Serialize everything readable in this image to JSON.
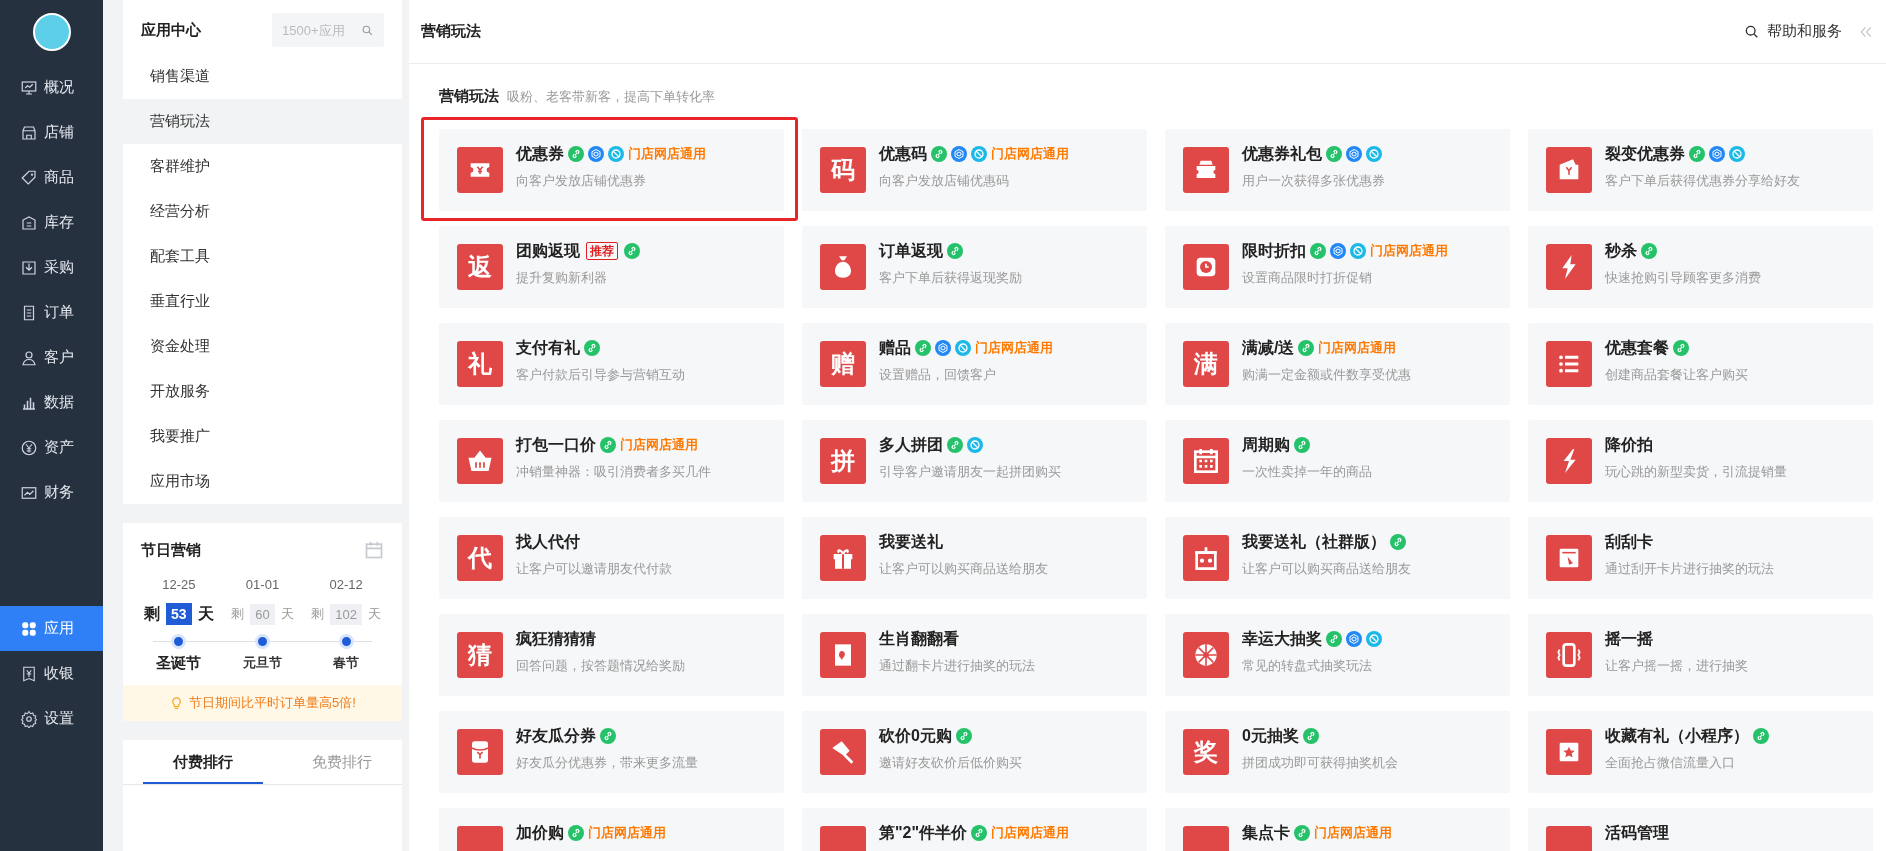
{
  "nav": {
    "items": [
      {
        "label": "概况",
        "selected": false
      },
      {
        "label": "店铺",
        "selected": false
      },
      {
        "label": "商品",
        "selected": false
      },
      {
        "label": "库存",
        "selected": false
      },
      {
        "label": "采购",
        "selected": false
      },
      {
        "label": "订单",
        "selected": false
      },
      {
        "label": "客户",
        "selected": false
      },
      {
        "label": "数据",
        "selected": false
      },
      {
        "label": "资产",
        "selected": false
      },
      {
        "label": "财务",
        "selected": false
      }
    ],
    "bottom_items": [
      {
        "label": "应用",
        "selected": true
      },
      {
        "label": "收银",
        "selected": false
      },
      {
        "label": "设置",
        "selected": false
      }
    ]
  },
  "app_center": {
    "title": "应用中心",
    "search": {
      "placeholder": "1500+应用"
    },
    "menu": [
      {
        "label": "销售渠道",
        "selected": false
      },
      {
        "label": "营销玩法",
        "selected": true
      },
      {
        "label": "客群维护",
        "selected": false
      },
      {
        "label": "经营分析",
        "selected": false
      },
      {
        "label": "配套工具",
        "selected": false
      },
      {
        "label": "垂直行业",
        "selected": false
      },
      {
        "label": "资金处理",
        "selected": false
      },
      {
        "label": "开放服务",
        "selected": false
      },
      {
        "label": "我要推广",
        "selected": false
      },
      {
        "label": "应用市场",
        "selected": false
      }
    ]
  },
  "festival": {
    "title": "节日营销",
    "items": [
      {
        "date": "12-25",
        "prefix": "剩",
        "days": "53",
        "suffix": "天",
        "name": "圣诞节",
        "selected": true
      },
      {
        "date": "01-01",
        "prefix": "剩",
        "days": "60",
        "suffix": "天",
        "name": "元旦节",
        "selected": false
      },
      {
        "date": "02-12",
        "prefix": "剩",
        "days": "102",
        "suffix": "天",
        "name": "春节",
        "selected": false
      }
    ],
    "tip": "节日期间比平时订单量高5倍!"
  },
  "ranking_tabs": [
    {
      "label": "付费排行",
      "selected": true
    },
    {
      "label": "免费排行",
      "selected": false
    }
  ],
  "header": {
    "title": "营销玩法",
    "help": "帮助和服务"
  },
  "section": {
    "title": "营销玩法",
    "subtitle": "吸粉、老客带新客，提高下单转化率"
  },
  "cards": [
    {
      "title": "优惠券",
      "desc": "向客户发放店铺优惠券",
      "highlighted": true,
      "badges": [
        {
          "kind": "link"
        },
        {
          "kind": "hex"
        },
        {
          "kind": "ring"
        },
        {
          "kind": "scope",
          "text": "门店网店通用"
        }
      ]
    },
    {
      "title": "优惠码",
      "icon_text": "码",
      "desc": "向客户发放店铺优惠码",
      "highlighted": false,
      "badges": [
        {
          "kind": "link"
        },
        {
          "kind": "hex"
        },
        {
          "kind": "ring"
        },
        {
          "kind": "scope",
          "text": "门店网店通用"
        }
      ]
    },
    {
      "title": "优惠券礼包",
      "desc": "用户一次获得多张优惠券",
      "highlighted": false,
      "badges": [
        {
          "kind": "link"
        },
        {
          "kind": "hex"
        },
        {
          "kind": "ring"
        }
      ]
    },
    {
      "title": "裂变优惠券",
      "desc": "客户下单后获得优惠券分享给好友",
      "highlighted": false,
      "badges": [
        {
          "kind": "link"
        },
        {
          "kind": "hex"
        },
        {
          "kind": "ring"
        }
      ]
    },
    {
      "title": "团购返现",
      "icon_text": "返",
      "desc": "提升复购新利器",
      "highlighted": false,
      "badges": [
        {
          "kind": "hot",
          "text": "推荐"
        },
        {
          "kind": "link"
        }
      ]
    },
    {
      "title": "订单返现",
      "desc": "客户下单后获得返现奖励",
      "highlighted": false,
      "badges": [
        {
          "kind": "link"
        }
      ]
    },
    {
      "title": "限时折扣",
      "desc": "设置商品限时打折促销",
      "highlighted": false,
      "badges": [
        {
          "kind": "link"
        },
        {
          "kind": "hex"
        },
        {
          "kind": "ring"
        },
        {
          "kind": "scope",
          "text": "门店网店通用"
        }
      ]
    },
    {
      "title": "秒杀",
      "desc": "快速抢购引导顾客更多消费",
      "highlighted": false,
      "badges": [
        {
          "kind": "link"
        }
      ]
    },
    {
      "title": "支付有礼",
      "icon_text": "礼",
      "desc": "客户付款后引导参与营销互动",
      "highlighted": false,
      "badges": [
        {
          "kind": "link"
        }
      ]
    },
    {
      "title": "赠品",
      "icon_text": "赠",
      "desc": "设置赠品，回馈客户",
      "highlighted": false,
      "badges": [
        {
          "kind": "link"
        },
        {
          "kind": "hex"
        },
        {
          "kind": "ring"
        },
        {
          "kind": "scope",
          "text": "门店网店通用"
        }
      ]
    },
    {
      "title": "满减/送",
      "icon_text": "满",
      "desc": "购满一定金额或件数享受优惠",
      "highlighted": false,
      "badges": [
        {
          "kind": "link"
        },
        {
          "kind": "scope",
          "text": "门店网店通用"
        }
      ]
    },
    {
      "title": "优惠套餐",
      "desc": "创建商品套餐让客户购买",
      "highlighted": false,
      "badges": [
        {
          "kind": "link"
        }
      ]
    },
    {
      "title": "打包一口价",
      "desc": "冲销量神器：吸引消费者多买几件",
      "highlighted": false,
      "badges": [
        {
          "kind": "link"
        },
        {
          "kind": "scope",
          "text": "门店网店通用"
        }
      ]
    },
    {
      "title": "多人拼团",
      "icon_text": "拼",
      "desc": "引导客户邀请朋友一起拼团购买",
      "highlighted": false,
      "badges": [
        {
          "kind": "link"
        },
        {
          "kind": "ring"
        }
      ]
    },
    {
      "title": "周期购",
      "desc": "一次性卖掉一年的商品",
      "highlighted": false,
      "badges": [
        {
          "kind": "link"
        }
      ]
    },
    {
      "title": "降价拍",
      "desc": "玩心跳的新型卖货，引流提销量",
      "highlighted": false
    },
    {
      "title": "找人代付",
      "icon_text": "代",
      "desc": "让客户可以邀请朋友代付款",
      "highlighted": false
    },
    {
      "title": "我要送礼",
      "desc": "让客户可以购买商品送给朋友",
      "highlighted": false
    },
    {
      "title": "我要送礼（社群版）",
      "desc": "让客户可以购买商品送给朋友",
      "highlighted": false,
      "badges": [
        {
          "kind": "link"
        }
      ]
    },
    {
      "title": "刮刮卡",
      "desc": "通过刮开卡片进行抽奖的玩法",
      "highlighted": false
    },
    {
      "title": "疯狂猜猜猜",
      "icon_text": "猜",
      "desc": "回答问题，按答题情况给奖励",
      "highlighted": false
    },
    {
      "title": "生肖翻翻看",
      "desc": "通过翻卡片进行抽奖的玩法",
      "highlighted": false
    },
    {
      "title": "幸运大抽奖",
      "desc": "常见的转盘式抽奖玩法",
      "highlighted": false,
      "badges": [
        {
          "kind": "link"
        },
        {
          "kind": "hex"
        },
        {
          "kind": "ring"
        }
      ]
    },
    {
      "title": "摇一摇",
      "desc": "让客户摇一摇，进行抽奖",
      "highlighted": false
    },
    {
      "title": "好友瓜分券",
      "desc": "好友瓜分优惠券，带来更多流量",
      "highlighted": false,
      "badges": [
        {
          "kind": "link"
        }
      ]
    },
    {
      "title": "砍价0元购",
      "desc": "邀请好友砍价后低价购买",
      "highlighted": false,
      "badges": [
        {
          "kind": "link"
        }
      ]
    },
    {
      "title": "0元抽奖",
      "icon_text": "奖",
      "desc": "拼团成功即可获得抽奖机会",
      "highlighted": false,
      "badges": [
        {
          "kind": "link"
        }
      ]
    },
    {
      "title": "收藏有礼（小程序）",
      "desc": "全面抢占微信流量入口",
      "highlighted": false,
      "badges": [
        {
          "kind": "link"
        }
      ]
    },
    {
      "title": "加价购",
      "highlighted": false,
      "badges": [
        {
          "kind": "link"
        },
        {
          "kind": "scope",
          "text": "门店网店通用"
        }
      ]
    },
    {
      "title": "第\"2\"件半价",
      "highlighted": false,
      "badges": [
        {
          "kind": "link"
        },
        {
          "kind": "scope",
          "text": "门店网店通用"
        }
      ]
    },
    {
      "title": "集点卡",
      "highlighted": false,
      "badges": [
        {
          "kind": "link"
        },
        {
          "kind": "scope",
          "text": "门店网店通用"
        }
      ]
    },
    {
      "title": "活码管理",
      "highlighted": false
    }
  ]
}
